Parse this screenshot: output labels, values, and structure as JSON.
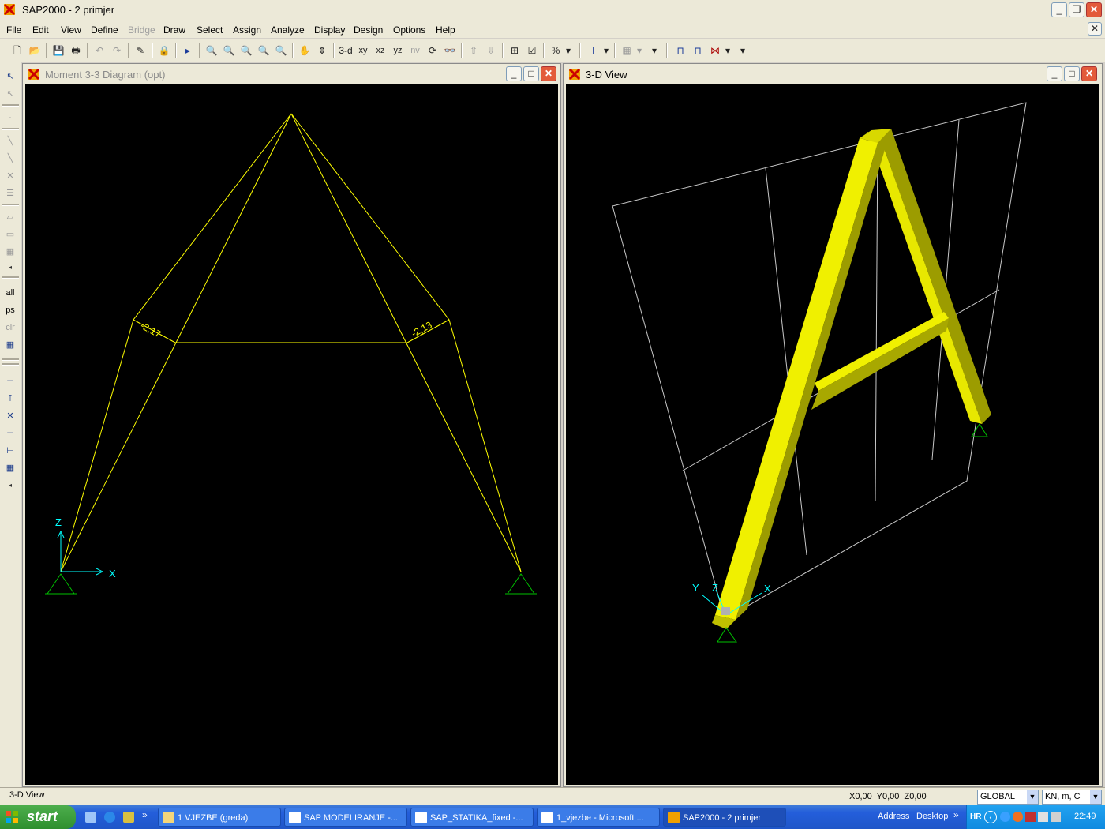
{
  "window": {
    "title": "SAP2000 - 2 primjer"
  },
  "menu": [
    "File",
    "Edit",
    "View",
    "Define",
    "Bridge",
    "Draw",
    "Select",
    "Assign",
    "Analyze",
    "Display",
    "Design",
    "Options",
    "Help"
  ],
  "menu_disabled": [
    "Bridge"
  ],
  "toolbar": {
    "view_3d": "3-d",
    "view_xy": "xy",
    "view_xz": "xz",
    "view_yz": "yz",
    "view_nv": "nv"
  },
  "left_toolbar": {
    "all": "all",
    "ps": "ps",
    "clr": "clr"
  },
  "moment_window": {
    "title": "Moment 3-3 Diagram   (opt)",
    "label_left": "-2,17",
    "label_right": "-2,13",
    "axis_z": "Z",
    "axis_x": "X"
  },
  "view3d_window": {
    "title": "3-D View",
    "axis_y": "Y",
    "axis_z": "Z",
    "axis_x": "X"
  },
  "statusbar": {
    "left": "3-D View",
    "coords": "X0,00  Y0,00  Z0,00",
    "coord_system": "GLOBAL",
    "units": "KN, m, C"
  },
  "taskbar": {
    "start": "start",
    "tasks": [
      {
        "label": "1 VJEZBE (greda)",
        "active": false
      },
      {
        "label": "SAP  MODELIRANJE -...",
        "active": false
      },
      {
        "label": "SAP_STATIKA_fixed -...",
        "active": false
      },
      {
        "label": "1_vjezbe - Microsoft ...",
        "active": false
      },
      {
        "label": "SAP2000 - 2 primjer",
        "active": true
      }
    ],
    "address": "Address",
    "desktop": "Desktop",
    "lang": "HR",
    "clock": "22:49"
  },
  "colors": {
    "frame_line": "#ffff00",
    "support": "#00c000",
    "axis": "#00ffff",
    "grid": "#c0c0c0",
    "member_face": "#f0f000",
    "member_side": "#9c9c00"
  }
}
